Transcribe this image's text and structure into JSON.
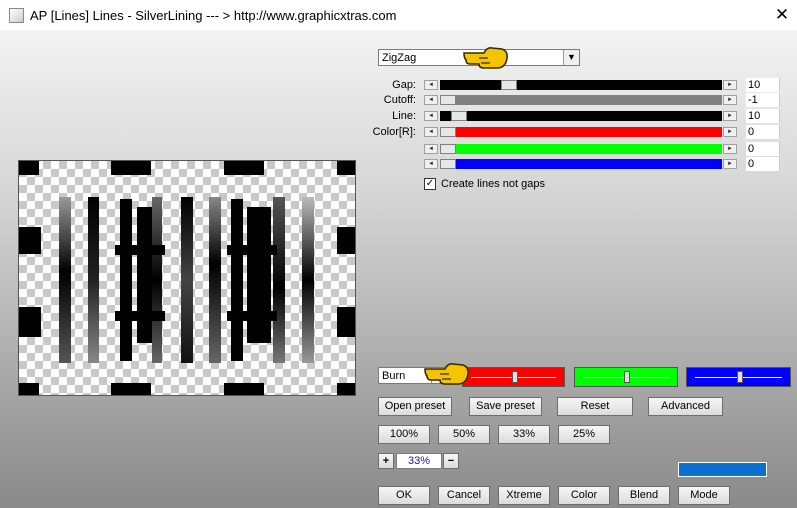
{
  "window": {
    "title": "AP [Lines]  Lines - SilverLining     --- > http://www.graphicxtras.com",
    "close_glyph": "✕"
  },
  "mode_dropdown": {
    "value": "ZigZag",
    "arrow": "▼"
  },
  "sliders": [
    {
      "label": "Gap:",
      "value": "10",
      "fill_color": "#000000",
      "thumb_fraction": 0.23
    },
    {
      "label": "Cutoff:",
      "value": "-1",
      "fill_color": "#808080",
      "thumb_fraction": 0.0
    },
    {
      "label": "Line:",
      "value": "10",
      "fill_color": "#000000",
      "thumb_fraction": 0.04
    },
    {
      "label": "Color[R]:",
      "value": "0",
      "fill_color": "#ff0000",
      "thumb_fraction": 0.0
    },
    {
      "label": "",
      "value": "0",
      "fill_color": "#00ff00",
      "thumb_fraction": 0.0
    },
    {
      "label": "",
      "value": "0",
      "fill_color": "#0000ff",
      "thumb_fraction": 0.0
    }
  ],
  "slider_arrows": {
    "left": "◄",
    "right": "►"
  },
  "checkbox": {
    "label": "Create lines not gaps",
    "checked": true,
    "mark": "✓"
  },
  "blend_dropdown": {
    "value": "Burn",
    "arrow": "▼"
  },
  "color_sliders": [
    {
      "color": "#ff0000",
      "level": 0.5
    },
    {
      "color": "#00ff00",
      "level": 0.5
    },
    {
      "color": "#0000ff",
      "level": 0.5
    }
  ],
  "preset_buttons": {
    "open": "Open preset",
    "save": "Save preset",
    "reset": "Reset",
    "advanced": "Advanced"
  },
  "zoom_buttons": {
    "z100": "100%",
    "z50": "50%",
    "z33": "33%",
    "z25": "25%"
  },
  "zoom": {
    "plus": "+",
    "minus": "−",
    "value": "33%"
  },
  "swatch_color": "#0b6fd0",
  "bottom_buttons": {
    "ok": "OK",
    "cancel": "Cancel",
    "xtreme": "Xtreme",
    "color": "Color",
    "blend": "Blend",
    "mode": "Mode"
  },
  "icons": {
    "pointer_hand": "pointing-hand-icon",
    "app": "app-icon",
    "close": "close-icon"
  }
}
